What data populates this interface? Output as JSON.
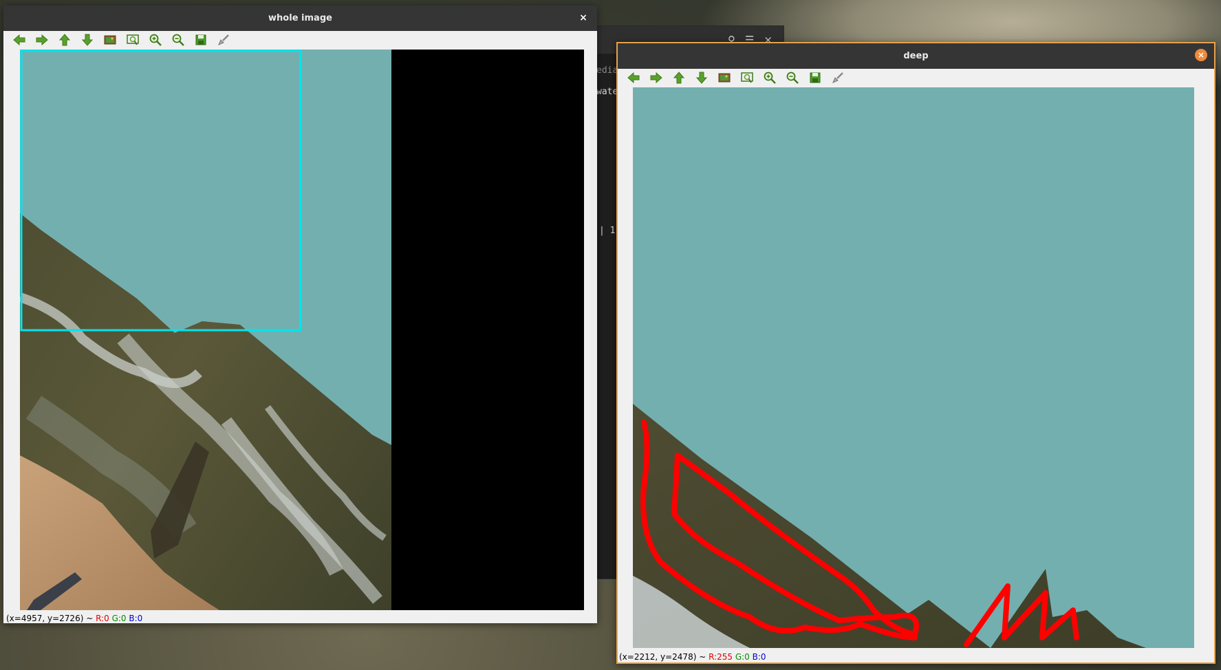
{
  "background_terminal": {
    "path_fragment": "edia/",
    "line1": "wate",
    "line2": "| 1",
    "search_icon": "search-icon",
    "menu_icon": "hamburger-icon",
    "close_label": "×"
  },
  "whole_window": {
    "title": "whole image",
    "close_label": "×",
    "status": {
      "coords": "(x=4957, y=2726) ~ ",
      "r": "R:0",
      "g": "G:0",
      "b": "B:0"
    }
  },
  "deep_window": {
    "title": "deep",
    "close_label": "×",
    "status": {
      "coords": "(x=2212, y=2478) ~ ",
      "r": "R:255",
      "g": "G:0",
      "b": "B:0"
    }
  },
  "toolbar_icons": [
    "arrow-left-icon",
    "arrow-right-icon",
    "arrow-up-icon",
    "arrow-down-icon",
    "image-icon",
    "zoom-fit-icon",
    "zoom-in-icon",
    "zoom-out-icon",
    "save-icon",
    "brush-icon"
  ],
  "colors": {
    "water": "#74afb0",
    "selection_rect": "#00e5ee",
    "annotation": "#ff0000",
    "window_accent": "#e8a24a"
  }
}
